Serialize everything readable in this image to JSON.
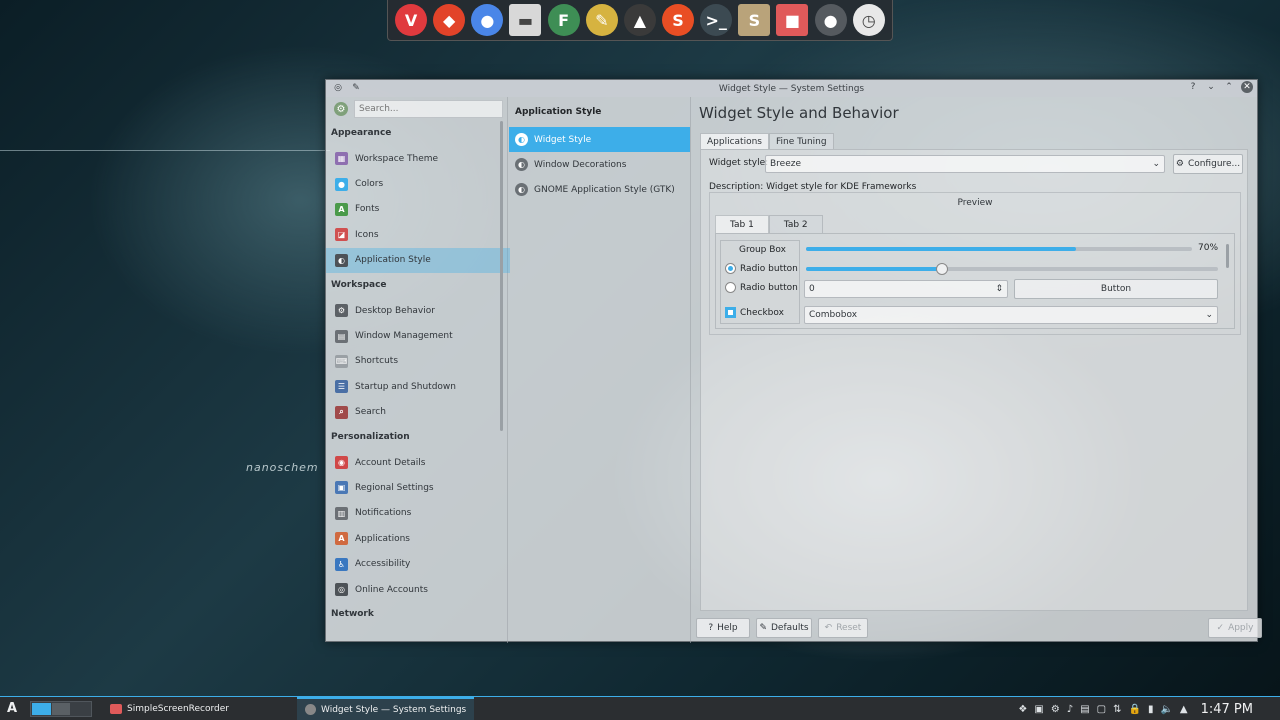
{
  "wallpaper": {
    "text": "nanoschem"
  },
  "dock": {
    "apps": [
      {
        "name": "vivaldi-icon",
        "glyph": "V",
        "color": "#e03a3e"
      },
      {
        "name": "gitlab-icon",
        "glyph": "◆",
        "color": "#e24329"
      },
      {
        "name": "chromium-icon",
        "glyph": "●",
        "color": "#4a86e8"
      },
      {
        "name": "files-icon",
        "glyph": "▬",
        "color": "#d8d8d8"
      },
      {
        "name": "feather-icon",
        "glyph": "F",
        "color": "#3e8e55"
      },
      {
        "name": "gimp-icon",
        "glyph": "✎",
        "color": "#d6b340"
      },
      {
        "name": "inkscape-icon",
        "glyph": "▲",
        "color": "#3a3a3a"
      },
      {
        "name": "swirl-app-icon",
        "glyph": "S",
        "color": "#e94e24"
      },
      {
        "name": "terminal-icon",
        "glyph": ">_",
        "color": "#3c4a52"
      },
      {
        "name": "scribus-icon",
        "glyph": "S",
        "color": "#b9a37a"
      },
      {
        "name": "screen-recorder-icon",
        "glyph": "■",
        "color": "#e05a5a"
      },
      {
        "name": "settings-icon",
        "glyph": "●",
        "color": "#555a5f"
      },
      {
        "name": "clock-icon",
        "glyph": "◷",
        "color": "#e8e8e8"
      }
    ]
  },
  "window": {
    "title": "Widget Style — System Settings",
    "controls": {
      "help": "?",
      "minimize": "⌄",
      "maximize": "⌃",
      "close": "✕"
    }
  },
  "sidebar": {
    "search_placeholder": "Search...",
    "sections": [
      {
        "header": "Appearance",
        "items": [
          {
            "label": "Workspace Theme",
            "icon": "workspace-theme-icon",
            "color": "#8e6fb0",
            "glyph": "▦"
          },
          {
            "label": "Colors",
            "icon": "colors-icon",
            "color": "#3daee9",
            "glyph": "●"
          },
          {
            "label": "Fonts",
            "icon": "fonts-icon",
            "color": "#4a9a4a",
            "glyph": "A"
          },
          {
            "label": "Icons",
            "icon": "icons-icon",
            "color": "#d05050",
            "glyph": "◪"
          },
          {
            "label": "Application Style",
            "icon": "application-style-icon",
            "color": "#4d5257",
            "glyph": "◐",
            "selected": true
          }
        ]
      },
      {
        "header": "Workspace",
        "items": [
          {
            "label": "Desktop Behavior",
            "icon": "desktop-behavior-icon",
            "color": "#5c6166",
            "glyph": "⚙"
          },
          {
            "label": "Window Management",
            "icon": "window-management-icon",
            "color": "#6b7075",
            "glyph": "▤"
          },
          {
            "label": "Shortcuts",
            "icon": "shortcuts-icon",
            "color": "#9aa0a5",
            "glyph": "⌨"
          },
          {
            "label": "Startup and Shutdown",
            "icon": "startup-shutdown-icon",
            "color": "#4a6fa5",
            "glyph": "☰"
          },
          {
            "label": "Search",
            "icon": "search-icon",
            "color": "#a04a4a",
            "glyph": "⌕"
          }
        ]
      },
      {
        "header": "Personalization",
        "items": [
          {
            "label": "Account Details",
            "icon": "account-details-icon",
            "color": "#d04848",
            "glyph": "◉"
          },
          {
            "label": "Regional Settings",
            "icon": "regional-settings-icon",
            "color": "#4a78b5",
            "glyph": "▣"
          },
          {
            "label": "Notifications",
            "icon": "notifications-icon",
            "color": "#6b7075",
            "glyph": "▥"
          },
          {
            "label": "Applications",
            "icon": "applications-icon",
            "color": "#d06a40",
            "glyph": "A"
          },
          {
            "label": "Accessibility",
            "icon": "accessibility-icon",
            "color": "#3a78c0",
            "glyph": "♿"
          },
          {
            "label": "Online Accounts",
            "icon": "online-accounts-icon",
            "color": "#4d5257",
            "glyph": "◎"
          }
        ]
      },
      {
        "header": "Network",
        "items": []
      }
    ]
  },
  "subnav": {
    "header": "Application Style",
    "items": [
      {
        "label": "Widget Style",
        "selected": true
      },
      {
        "label": "Window Decorations"
      },
      {
        "label": "GNOME Application Style (GTK)"
      }
    ]
  },
  "main": {
    "title": "Widget Style and Behavior",
    "tabs": [
      "Applications",
      "Fine Tuning"
    ],
    "widget_style_label": "Widget style:",
    "widget_style_value": "Breeze",
    "configure_label": "Configure...",
    "description": "Description: Widget style for KDE Frameworks",
    "preview": {
      "title": "Preview",
      "tabs": [
        "Tab 1",
        "Tab 2"
      ],
      "group_box_label": "Group Box",
      "radio1": "Radio button",
      "radio2": "Radio button",
      "checkbox": "Checkbox",
      "progress_percent": 70,
      "progress_label": "70%",
      "slider_value": 0.33,
      "spin_value": "0",
      "button_label": "Button",
      "combobox_label": "Combobox"
    },
    "buttons": {
      "help": "Help",
      "defaults": "Defaults",
      "reset": "Reset",
      "apply": "Apply"
    }
  },
  "taskbar": {
    "launcher_glyph": "A",
    "tasks": [
      {
        "label": "SimpleScreenRecorder"
      },
      {
        "label": "Widget Style  — System Settings",
        "active": true
      }
    ],
    "clock": "1:47 PM"
  }
}
